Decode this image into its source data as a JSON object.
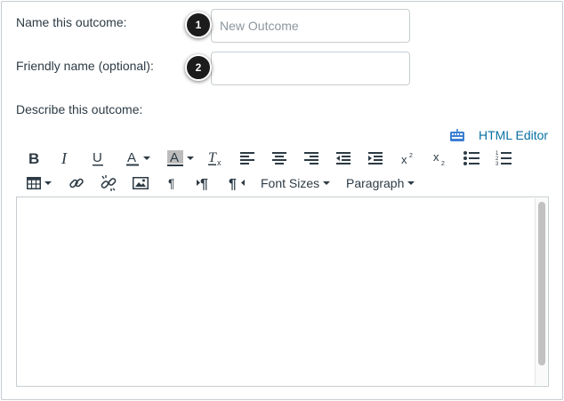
{
  "form": {
    "name_label": "Name this outcome:",
    "name_placeholder": "New Outcome",
    "name_value": "",
    "friendly_label": "Friendly name (optional):",
    "friendly_value": "",
    "describe_label": "Describe this outcome:"
  },
  "callouts": [
    "1",
    "2"
  ],
  "editor": {
    "html_editor_label": "HTML Editor",
    "font_sizes_label": "Font Sizes",
    "paragraph_label": "Paragraph",
    "content": ""
  },
  "toolbar_icons": {
    "row1": [
      "bold-icon",
      "italic-icon",
      "underline-icon",
      "text-color-icon",
      "background-color-icon",
      "clear-formatting-icon",
      "align-left-icon",
      "align-center-icon",
      "align-right-icon",
      "outdent-icon",
      "indent-icon",
      "superscript-icon",
      "subscript-icon",
      "bullet-list-icon",
      "numbered-list-icon"
    ],
    "row2": [
      "table-icon",
      "link-icon",
      "unlink-icon",
      "image-icon",
      "paragraph-mark-icon",
      "ltr-icon",
      "rtl-icon"
    ]
  },
  "colors": {
    "text": "#2d3b45",
    "link": "#0770a3",
    "border": "#c7cdd1",
    "callout_bg": "#1c1c1c",
    "placeholder": "#8b969e"
  }
}
